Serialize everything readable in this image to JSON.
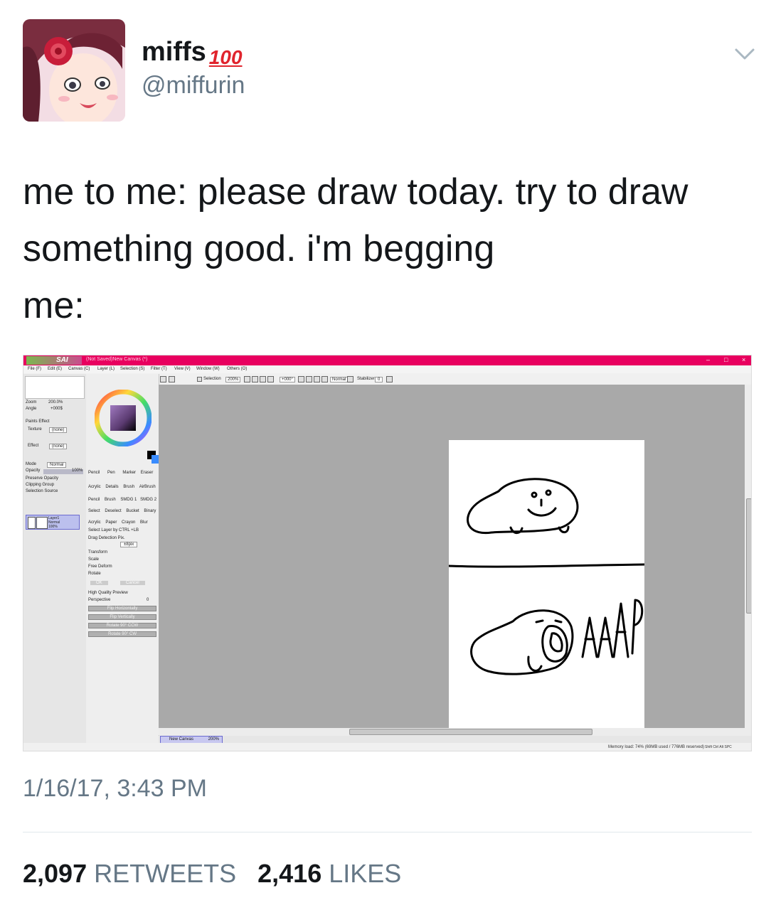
{
  "user": {
    "display_name": "miffs",
    "emoji": "100",
    "handle": "@miffurin",
    "avatar_icon": "anime-avatar-icon"
  },
  "tweet": {
    "line1": "me to me: please draw today. try to draw",
    "line2": "something good. i'm begging",
    "line3": "me:"
  },
  "app": {
    "logo": "SAI",
    "title": "(Not Saved)New Canvas (*)",
    "menu": [
      "File (F)",
      "Edit (E)",
      "Canvas (C)",
      "Layer (L)",
      "Selection (S)",
      "Filter (T)",
      "View (V)",
      "Window (W)",
      "Others (O)"
    ],
    "toolbar": {
      "selection": "Selection",
      "zoom": "200%",
      "angle": "+000°",
      "blend": "Normal",
      "stabilizer_label": "Stabilizer",
      "stabilizer_value": "0"
    },
    "nav": {
      "zoom_label": "Zoom",
      "zoom_value": "200.0%",
      "angle_label": "Angle",
      "angle_value": "+000$"
    },
    "paper_effect": "Paints Effect",
    "texture_label": "Texture",
    "texture_value": "(none)",
    "effect_label": "Effect",
    "effect_value": "(none)",
    "mode_label": "Mode",
    "mode_value": "Normal",
    "opacity_label": "Opacity",
    "opacity_value": "100%",
    "checks": [
      "Preserve Opacity",
      "Clipping Group",
      "Selection Source"
    ],
    "layer": {
      "name": "Layer1",
      "mode": "Normal",
      "opacity": "100%"
    },
    "tools": [
      [
        "Pencil",
        "Pen",
        "Marker",
        "Eraser"
      ],
      [
        "Acrylic",
        "Details",
        "Brush",
        "AirBrush"
      ],
      [
        "Pencil",
        "Brush",
        "SMDG 1",
        "SMDG 2"
      ],
      [
        "Select",
        "Deselect",
        "Bucket",
        "Binary"
      ],
      [
        "Acrylic",
        "Paper",
        "Crayon",
        "Blur"
      ]
    ],
    "select_layer": "Select Layer by CTRL +LB",
    "drag_detection": "Drag Detection Pix.",
    "drag_value": "±8pix",
    "transforms": [
      "Transform",
      "Scale",
      "Free Deform",
      "Rotate"
    ],
    "ok": "OK",
    "cancel": "Cancel",
    "hq_preview": "High Quality Preview",
    "perspective_label": "Perspective",
    "perspective_value": "0",
    "flip_buttons": [
      "Flip Horizontally",
      "Flip Vertically",
      "Rotate 90° CCW",
      "Rotate 90° CW"
    ],
    "canvas_tab": "New Canvas",
    "canvas_tab_zoom": "200%",
    "status": "Memory load: 74% (69MB used / 776MB reserved)",
    "status_keys": "Shift Ctrl Alt SPC",
    "drawing_text": "AAA",
    "accent_color": "#e8005f"
  },
  "meta": {
    "timestamp": "1/16/17, 3:43 PM",
    "retweets_count": "2,097",
    "retweets_label": "RETWEETS",
    "likes_count": "2,416",
    "likes_label": "LIKES"
  }
}
